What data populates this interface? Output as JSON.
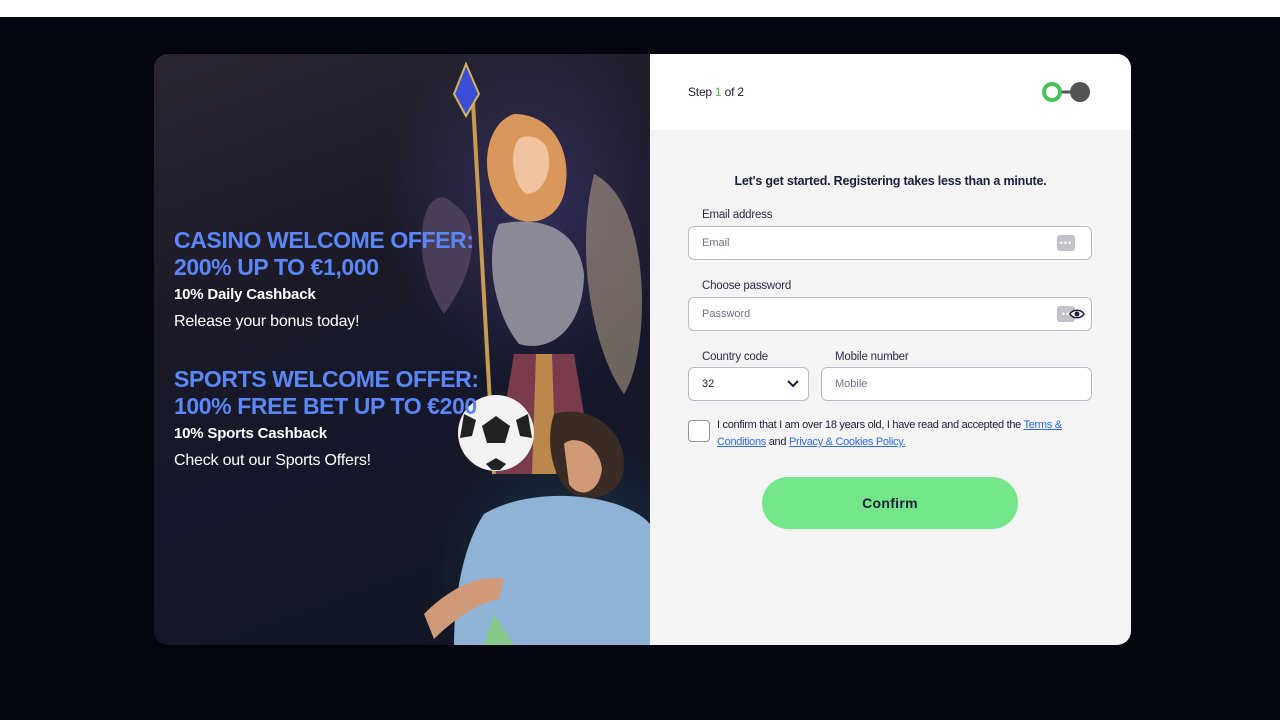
{
  "promo": {
    "casino_title_line1": "CASINO WELCOME OFFER:",
    "casino_title_line2": "200% UP TO €1,000",
    "casino_cashback": "10% Daily Cashback",
    "casino_cta": "Release your bonus today!",
    "sports_title_line1": "SPORTS WELCOME OFFER:",
    "sports_title_line2": "100% FREE BET UP TO €200",
    "sports_cashback": "10% Sports Cashback",
    "sports_cta": "Check out our Sports Offers!"
  },
  "step": {
    "prefix": "Step ",
    "current": "1",
    "suffix": " of 2"
  },
  "form": {
    "intro": "Let's get started. Registering takes less than a minute.",
    "email_label": "Email address",
    "email_placeholder": "Email",
    "password_label": "Choose password",
    "password_placeholder": "Password",
    "country_label": "Country code",
    "country_value": "32",
    "mobile_label": "Mobile number",
    "mobile_placeholder": "Mobile",
    "consent_text": "I confirm that I am over 18 years old, I have read and accepted the ",
    "terms_link": "Terms & Conditions",
    "consent_and": " and ",
    "privacy_link": "Privacy & Cookies Policy.",
    "confirm_label": "Confirm"
  },
  "colors": {
    "offer_title": "#5b86f5",
    "accent_green": "#74e68a",
    "step_green": "#44c25b",
    "backdrop": "#03050f"
  }
}
